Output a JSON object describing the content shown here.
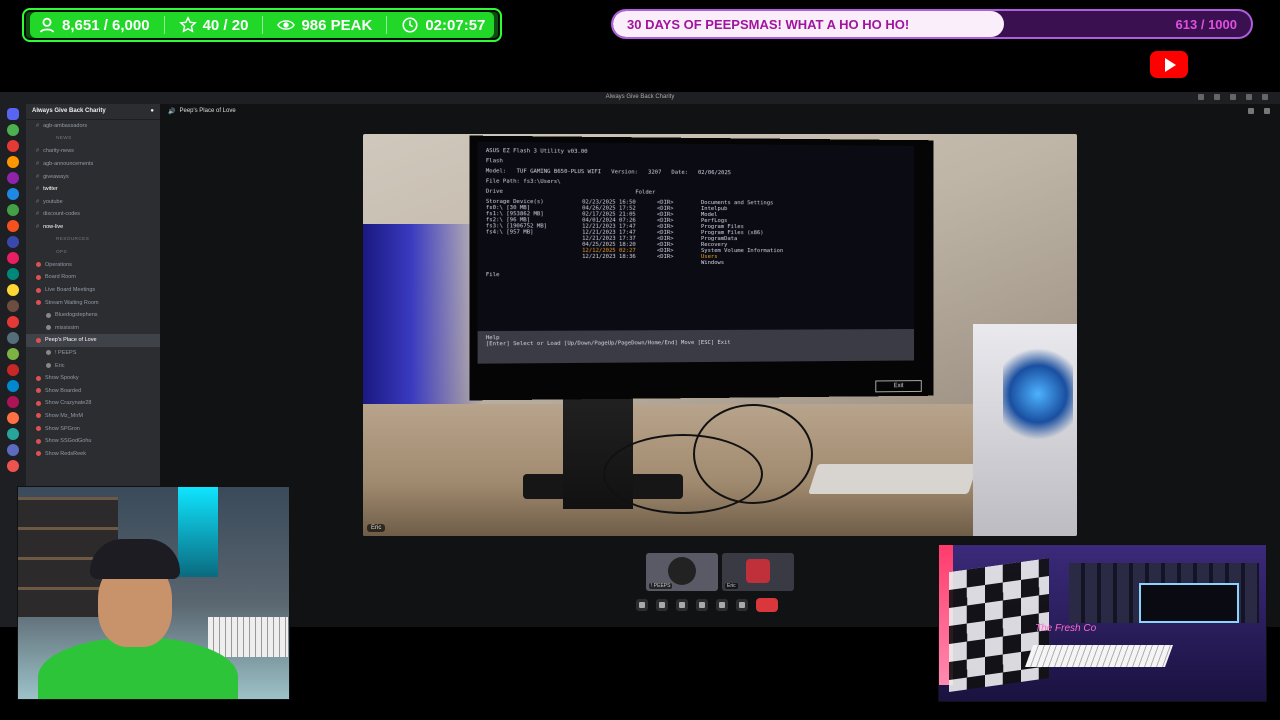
{
  "overlay": {
    "stats": {
      "followers": "8,651 / 6,000",
      "stars": "40 / 20",
      "peak": "986 PEAK",
      "timer": "02:07:57"
    },
    "goal": {
      "title": "30 DAYS OF PEEPSMAS! WHAT A HO HO HO!",
      "count": "613 / 1000",
      "progress": 0.613
    }
  },
  "discord": {
    "window_title": "Always Give Back Charity",
    "guild_name": "Always Give Back Charity",
    "header_channel": "Peep's Place of Love",
    "channels": [
      {
        "label": "agb-ambassadors",
        "type": "text"
      },
      {
        "label": "NEWS",
        "type": "category"
      },
      {
        "label": "charity-news",
        "type": "text"
      },
      {
        "label": "agb-announcements",
        "type": "text"
      },
      {
        "label": "giveaways",
        "type": "text"
      },
      {
        "label": "twitter",
        "type": "text",
        "bold": true
      },
      {
        "label": "youtube",
        "type": "text"
      },
      {
        "label": "discount-codes",
        "type": "text"
      },
      {
        "label": "now-live",
        "type": "text",
        "bold": true
      },
      {
        "label": "RESOURCES",
        "type": "category"
      },
      {
        "label": "OPS",
        "type": "category"
      },
      {
        "label": "Operations",
        "type": "voice"
      },
      {
        "label": "Board Room",
        "type": "voice"
      },
      {
        "label": "Live Board Meetings",
        "type": "voice"
      },
      {
        "label": "Stream Waiting Room",
        "type": "voice"
      },
      {
        "label": "Bluedogstephens",
        "type": "user"
      },
      {
        "label": "mississim",
        "type": "user"
      },
      {
        "label": "Peep's Place of Love",
        "type": "voice",
        "active": true
      },
      {
        "label": "! PEEPS",
        "type": "user"
      },
      {
        "label": "Eric",
        "type": "user"
      },
      {
        "label": "Show Spooky",
        "type": "voice"
      },
      {
        "label": "Show Boarded",
        "type": "voice"
      },
      {
        "label": "Show Crazynate28",
        "type": "voice"
      },
      {
        "label": "Show Mz_MnM",
        "type": "voice"
      },
      {
        "label": "Show SPGron",
        "type": "voice"
      },
      {
        "label": "Show SSGodGohu",
        "type": "voice"
      },
      {
        "label": "Show RedsReek",
        "type": "voice"
      }
    ],
    "stage_tag": "Eric",
    "tiles": [
      {
        "label": "! PEEPS"
      },
      {
        "label": "Eric"
      }
    ]
  },
  "bios": {
    "title": "ASUS EZ Flash 3 Utility v03.00",
    "section": "Flash",
    "model_label": "Model:",
    "model_value": "TUF GAMING B650-PLUS WIFI",
    "version_label": "Version:",
    "version_value": "3207",
    "date_label": "Date:",
    "date_value": "02/06/2025",
    "file_path": "File Path: fs3:\\Users\\",
    "drive_header": "Drive",
    "folder_header": "Folder",
    "drives": [
      "Storage Device(s)",
      "fs0:\\ [30 MB]",
      "fs1:\\ [953862 MB]",
      "fs2:\\ [96 MB]",
      "fs3:\\ [1906752 MB]",
      "fs4:\\ [957 MB]"
    ],
    "folder_dates": [
      "02/23/2025 16:50",
      "04/26/2025 17:52",
      "02/17/2025 21:05",
      "04/01/2024 07:26",
      "12/21/2023 17:47",
      "12/21/2023 17:47",
      "12/21/2023 17:37",
      "04/25/2025 18:20",
      "12/12/2025 02:27",
      "12/21/2023 18:36"
    ],
    "folder_names": [
      "Documents and Settings",
      "Intelpub",
      "Model",
      "PerfLogs",
      "Program Files",
      "Program Files (x86)",
      "ProgramData",
      "Recovery",
      "System Volume Information",
      "Users",
      "Windows"
    ],
    "file_section": "File",
    "help_title": "Help",
    "help_text": "[Enter] Select or Load  [Up/Down/PageUp/PageDown/Home/End] Move  [ESC] Exit",
    "exit_label": "Exit"
  },
  "webcam": {
    "right_neon": "The Fresh Co"
  },
  "colors": {
    "stats_green": "#21d829",
    "goal_purple": "#b05ee0",
    "discord_bg": "#1e1f22",
    "end_call_red": "#da373c",
    "youtube_red": "#ff0000"
  }
}
